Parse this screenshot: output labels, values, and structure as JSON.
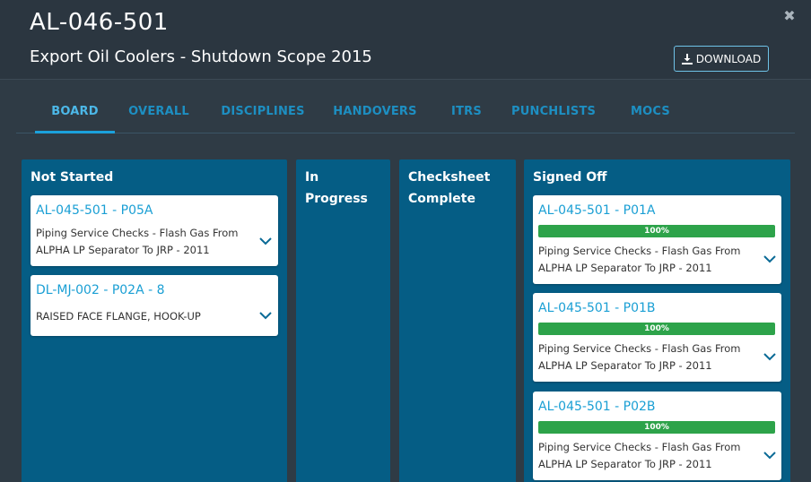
{
  "modal": {
    "title": "AL-046-501",
    "subtitle": "Export Oil Coolers - Shutdown Scope 2015",
    "download_label": "DOWNLOAD"
  },
  "tabs": [
    {
      "label": "BOARD",
      "active": true
    },
    {
      "label": "OVERALL"
    },
    {
      "label": "DISCIPLINES"
    },
    {
      "label": "HANDOVERS"
    },
    {
      "label": "ITRS"
    },
    {
      "label": "PUNCHLISTS"
    },
    {
      "label": "MOCS"
    }
  ],
  "board": {
    "columns": [
      {
        "title": "Not Started",
        "cards": [
          {
            "id": "AL-045-501 - P05A",
            "desc": "Piping Service Checks - Flash Gas From ALPHA LP Separator To JRP - 2011"
          },
          {
            "id": "DL-MJ-002 - P02A - 8",
            "desc": "RAISED FACE FLANGE, HOOK-UP"
          }
        ]
      },
      {
        "title_line1": "In",
        "title_line2": "Progress",
        "cards": []
      },
      {
        "title_line1": "Checksheet",
        "title_line2": "Complete",
        "cards": []
      },
      {
        "title": "Signed Off",
        "cards": [
          {
            "id": "AL-045-501 - P01A",
            "progress": "100%",
            "desc": "Piping Service Checks - Flash Gas From ALPHA LP Separator To JRP - 2011"
          },
          {
            "id": "AL-045-501 - P01B",
            "progress": "100%",
            "desc": "Piping Service Checks - Flash Gas From ALPHA LP Separator To JRP - 2011"
          },
          {
            "id": "AL-045-501 - P02B",
            "progress": "100%",
            "desc": "Piping Service Checks - Flash Gas From ALPHA LP Separator To JRP - 2011"
          }
        ]
      }
    ]
  },
  "colors": {
    "accent": "#1a9fd4",
    "column_bg": "#055d85",
    "progress_green": "#2da34a",
    "header_bg": "#2b3640"
  },
  "icons": {
    "close": "close-icon",
    "download": "download-icon",
    "expand": "chevron-down-icon"
  }
}
